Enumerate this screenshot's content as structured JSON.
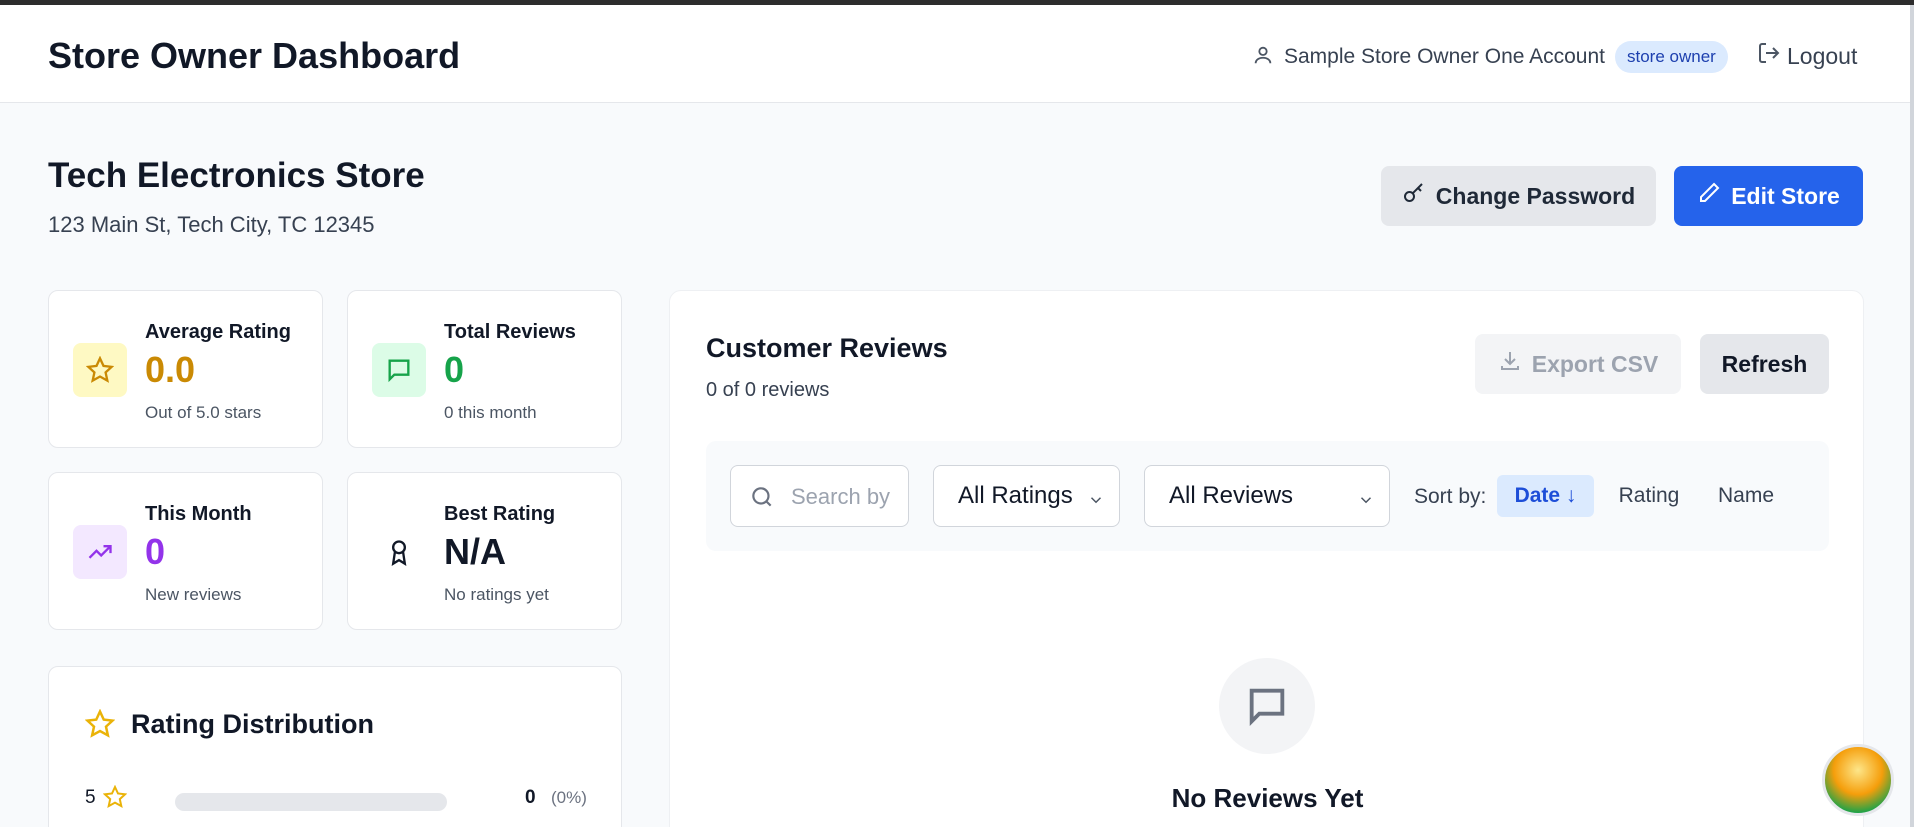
{
  "header": {
    "title": "Store Owner Dashboard",
    "user_name": "Sample Store Owner One Account",
    "role_badge": "store owner",
    "logout_label": "Logout"
  },
  "store": {
    "name": "Tech Electronics Store",
    "address": "123 Main St, Tech City, TC 12345",
    "change_password_label": "Change Password",
    "edit_store_label": "Edit Store"
  },
  "stats": {
    "average_rating": {
      "label": "Average Rating",
      "value": "0.0",
      "sub": "Out of 5.0 stars"
    },
    "total_reviews": {
      "label": "Total Reviews",
      "value": "0",
      "sub": "0 this month"
    },
    "this_month": {
      "label": "This Month",
      "value": "0",
      "sub": "New reviews"
    },
    "best_rating": {
      "label": "Best Rating",
      "value": "N/A",
      "sub": "No ratings yet"
    }
  },
  "distribution": {
    "title": "Rating Distribution",
    "rows": [
      {
        "stars": "5",
        "count": "0",
        "percent": "(0%)",
        "fraction": 0
      }
    ]
  },
  "reviews": {
    "title": "Customer Reviews",
    "count_text": "0 of 0 reviews",
    "export_label": "Export CSV",
    "refresh_label": "Refresh",
    "search_placeholder": "Search by",
    "rating_filter": "All Ratings",
    "review_filter": "All Reviews",
    "sort_label": "Sort by:",
    "sort_options": [
      "Date ↓",
      "Rating",
      "Name"
    ],
    "empty_title": "No Reviews Yet"
  },
  "colors": {
    "primary": "#2563eb",
    "rating": "#ca8a04",
    "reviews": "#16a34a",
    "month": "#9333ea"
  },
  "icons": [
    "user-icon",
    "logout-icon",
    "key-icon",
    "pencil-icon",
    "star-icon",
    "message-icon",
    "trending-up-icon",
    "award-icon",
    "download-icon",
    "search-icon",
    "chevron-down-icon"
  ]
}
